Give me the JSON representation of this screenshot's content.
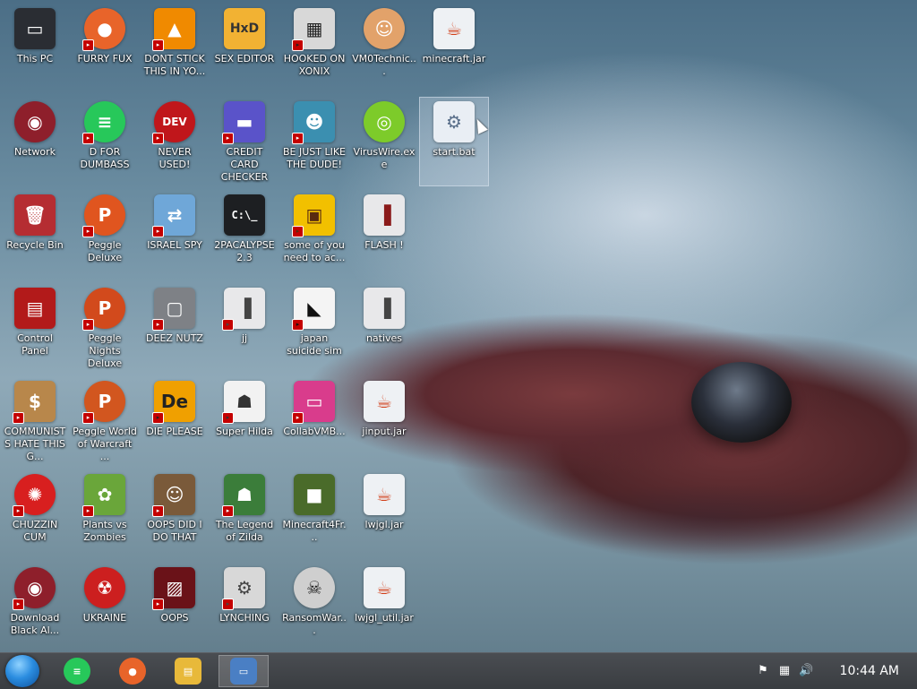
{
  "desktop": {
    "icons": [
      {
        "label": "This PC",
        "icon": "computer-icon",
        "color": "#2a2d33",
        "glyph": "▭"
      },
      {
        "label": "FURRY FUX",
        "icon": "firefox-icon",
        "color": "#e8642a",
        "glyph": "●"
      },
      {
        "label": "DONT STICK THIS IN YO...",
        "icon": "vlc-cone-icon",
        "color": "#f08a00",
        "glyph": "▲"
      },
      {
        "label": "SEX EDITOR",
        "icon": "hxd-editor-icon",
        "color": "#f2b233",
        "glyph": "HxD"
      },
      {
        "label": "HOOKED ON XONIX",
        "icon": "xonix-game-icon",
        "color": "#d8d8d8",
        "glyph": "▦"
      },
      {
        "label": "VM0Technic...",
        "icon": "doctor-person-icon",
        "color": "#e2a26a",
        "glyph": "☺"
      },
      {
        "label": "minecraft.jar",
        "icon": "java-jar-icon",
        "color": "#eef1f4",
        "glyph": "☕"
      },
      {
        "label": "Network",
        "icon": "network-globe-icon",
        "color": "#8e1f2b",
        "glyph": "◉"
      },
      {
        "label": "D FOR DUMBASS",
        "icon": "chat-app-icon",
        "color": "#27c85a",
        "glyph": "≡"
      },
      {
        "label": "NEVER USED!",
        "icon": "dev-cpp-icon",
        "color": "#c0161b",
        "glyph": "DEV"
      },
      {
        "label": "CREDIT CARD CHECKER",
        "icon": "credit-card-icon",
        "color": "#5a53c9",
        "glyph": "▬"
      },
      {
        "label": "BE JUST LIKE THE DUDE!",
        "icon": "santa-elf-icon",
        "color": "#3b8fb0",
        "glyph": "☻"
      },
      {
        "label": "VirusWire.exe",
        "icon": "lime-wire-icon",
        "color": "#7dcb2a",
        "glyph": "◎"
      },
      {
        "label": "start.bat",
        "icon": "batch-file-gear-icon",
        "color": "#e9eef4",
        "glyph": "⚙"
      },
      {
        "label": "Recycle Bin",
        "icon": "recycle-bin-icon",
        "color": "#b52d32",
        "glyph": "🗑"
      },
      {
        "label": "Peggle Deluxe",
        "icon": "peggle-icon",
        "color": "#e0551f",
        "glyph": "P"
      },
      {
        "label": "ISRAEL SPY",
        "icon": "network-share-icon",
        "color": "#6fa7d8",
        "glyph": "⇄"
      },
      {
        "label": "2PACALYPSE 2.3",
        "icon": "terminal-icon",
        "color": "#1d1f22",
        "glyph": "C:\\_"
      },
      {
        "label": "some of you need to ac...",
        "icon": "dog-icon",
        "color": "#f2c000",
        "glyph": "▣"
      },
      {
        "label": "FLASH !",
        "icon": "flash-document-icon",
        "color": "#e8e8ea",
        "glyph": "▐"
      },
      {
        "label": "Control Panel",
        "icon": "control-panel-icon",
        "color": "#b21a1a",
        "glyph": "▤"
      },
      {
        "label": "Peggle Nights Deluxe",
        "icon": "peggle-nights-icon",
        "color": "#d24a1c",
        "glyph": "P"
      },
      {
        "label": "DEEZ NUTZ",
        "icon": "stacked-windows-icon",
        "color": "#7e8186",
        "glyph": "▢"
      },
      {
        "label": "jj",
        "icon": "generic-document-icon",
        "color": "#e8e8ea",
        "glyph": "▐"
      },
      {
        "label": "japan suicide sim",
        "icon": "game-shortcut-icon",
        "color": "#f4f4f4",
        "glyph": "◣"
      },
      {
        "label": "natives",
        "icon": "folder-document-icon",
        "color": "#e8e8ea",
        "glyph": "▐"
      },
      {
        "label": "COMMUNISTS HATE THIS G...",
        "icon": "money-bag-icon",
        "color": "#b8874b",
        "glyph": "$"
      },
      {
        "label": "Peggle World of Warcraft ...",
        "icon": "peggle-wow-icon",
        "color": "#d2561f",
        "glyph": "P"
      },
      {
        "label": "DIE PLEASE",
        "icon": "de-letters-icon",
        "color": "#f0a000",
        "glyph": "De"
      },
      {
        "label": "Super Hilda",
        "icon": "pixel-character-icon",
        "color": "#f2f2f2",
        "glyph": "☗"
      },
      {
        "label": "CollabVMB...",
        "icon": "monitor-screen-icon",
        "color": "#d93c8c",
        "glyph": "▭"
      },
      {
        "label": "jinput.jar",
        "icon": "java-jar-icon",
        "color": "#eef1f4",
        "glyph": "☕"
      },
      {
        "label": "CHUZZIN CUM",
        "icon": "chuzzle-icon",
        "color": "#d81f1f",
        "glyph": "✺"
      },
      {
        "label": "Plants vs Zombies",
        "icon": "flower-icon",
        "color": "#6aa63a",
        "glyph": "✿"
      },
      {
        "label": "OOPS DID I DO THAT",
        "icon": "portrait-icon",
        "color": "#7a5a3a",
        "glyph": "☺"
      },
      {
        "label": "The Legend of Zilda",
        "icon": "pixel-hero-icon",
        "color": "#3b7d3a",
        "glyph": "☗"
      },
      {
        "label": "Minecraft4Fr...",
        "icon": "minecraft-block-icon",
        "color": "#4a6b2a",
        "glyph": "■"
      },
      {
        "label": "lwjgl.jar",
        "icon": "java-jar-icon",
        "color": "#eef1f4",
        "glyph": "☕"
      },
      {
        "label": "Download Black Al...",
        "icon": "network-globe-icon",
        "color": "#8e1f2b",
        "glyph": "◉"
      },
      {
        "label": "UKRAINE",
        "icon": "radiation-icon",
        "color": "#cc1f1f",
        "glyph": "☢"
      },
      {
        "label": "OOPS",
        "icon": "red-window-icon",
        "color": "#6a1218",
        "glyph": "▨"
      },
      {
        "label": "LYNCHING",
        "icon": "gear-rope-icon",
        "color": "#d8d8d8",
        "glyph": "⚙"
      },
      {
        "label": "RansomWar...",
        "icon": "skull-icon",
        "color": "#cfcfcf",
        "glyph": "☠"
      },
      {
        "label": "lwjgl_util.jar",
        "icon": "java-jar-icon",
        "color": "#eef1f4",
        "glyph": "☕"
      }
    ]
  },
  "taskbar": {
    "apps": [
      {
        "name": "chat-app-taskbar-icon",
        "color": "#27c85a",
        "glyph": "≡"
      },
      {
        "name": "firefox-taskbar-icon",
        "color": "#e8642a",
        "glyph": "●"
      },
      {
        "name": "file-explorer-taskbar-icon",
        "color": "#e8b93a",
        "glyph": "▤"
      },
      {
        "name": "remote-desktop-taskbar-icon",
        "color": "#4a7fc4",
        "glyph": "▭"
      }
    ],
    "clock": "10:44 AM"
  }
}
